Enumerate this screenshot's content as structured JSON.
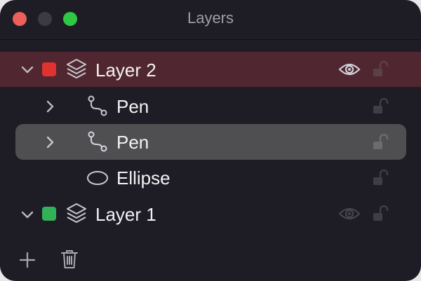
{
  "window": {
    "title": "Layers"
  },
  "layers": [
    {
      "name": "Layer 2",
      "expanded": true,
      "color": "#e0322f",
      "selected_state": "highlighted",
      "visible": true,
      "locked": false
    },
    {
      "name": "Pen",
      "type": "pen",
      "expandable": true,
      "locked": false
    },
    {
      "name": "Pen",
      "type": "pen",
      "expandable": true,
      "selected": true,
      "locked": false
    },
    {
      "name": "Ellipse",
      "type": "ellipse",
      "expandable": false,
      "locked": false
    },
    {
      "name": "Layer 1",
      "expanded": true,
      "color": "#32b257",
      "visible": true,
      "locked": false
    }
  ],
  "toolbar": {
    "add_icon": "plus-icon",
    "delete_icon": "trash-icon"
  },
  "colors": {
    "background": "#1e1d25",
    "layer2_highlight": "#502730",
    "selection": "#4f4e51"
  }
}
